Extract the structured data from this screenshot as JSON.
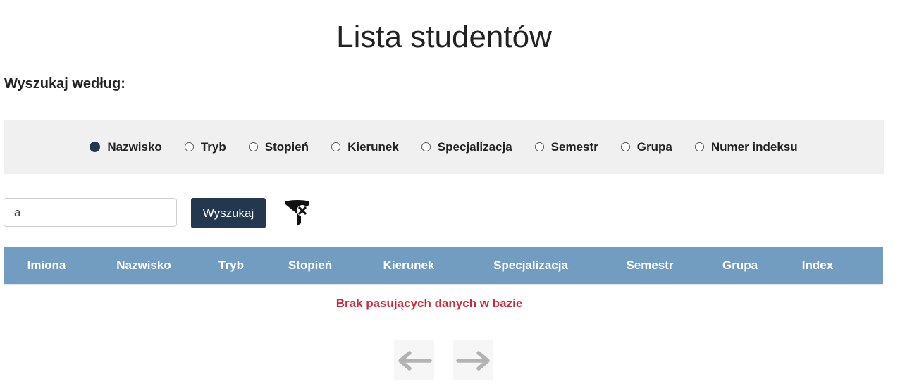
{
  "page": {
    "title": "Lista studentów",
    "search_by_label": "Wyszukaj według:"
  },
  "search_options": [
    {
      "label": "Nazwisko",
      "checked": true
    },
    {
      "label": "Tryb",
      "checked": false
    },
    {
      "label": "Stopień",
      "checked": false
    },
    {
      "label": "Kierunek",
      "checked": false
    },
    {
      "label": "Specjalizacja",
      "checked": false
    },
    {
      "label": "Semestr",
      "checked": false
    },
    {
      "label": "Grupa",
      "checked": false
    },
    {
      "label": "Numer indeksu",
      "checked": false
    }
  ],
  "search": {
    "value": "a",
    "button_label": "Wyszukaj",
    "clear_filter_icon": "funnel-x-icon"
  },
  "table": {
    "headers": [
      "Imiona",
      "Nazwisko",
      "Tryb",
      "Stopień",
      "Kierunek",
      "Specjalizacja",
      "Semestr",
      "Grupa",
      "Index"
    ],
    "empty_message": "Brak pasujących danych w bazie"
  },
  "pagination": {
    "prev_icon": "arrow-left-icon",
    "next_icon": "arrow-right-icon"
  },
  "colors": {
    "accent": "#23384f",
    "table_header": "#729dc1",
    "error_text": "#d0283b",
    "panel_bg": "#f0f0f0"
  }
}
